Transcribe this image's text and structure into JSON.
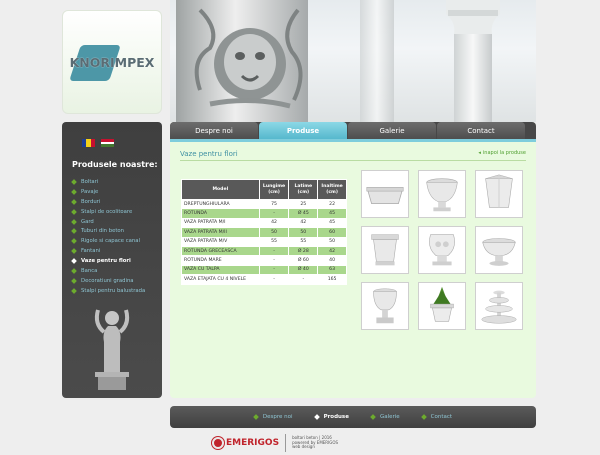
{
  "site": {
    "logo_text": "KNORIMPEX"
  },
  "colors": {
    "accent": "#56b8cd",
    "green": "#6dab2e",
    "panel": "#e9fadf",
    "dark": "#474747"
  },
  "sidebar": {
    "title": "Produsele noastre:",
    "items": [
      {
        "label": "Boltari"
      },
      {
        "label": "Pavaje"
      },
      {
        "label": "Borduri"
      },
      {
        "label": "Stalpi de ocolitoare"
      },
      {
        "label": "Gard"
      },
      {
        "label": "Tuburi din beton"
      },
      {
        "label": "Rigole si capace canal"
      },
      {
        "label": "Fantani"
      },
      {
        "label": "Vaze pentru flori"
      },
      {
        "label": "Banca"
      },
      {
        "label": "Decoratiuni gradina"
      },
      {
        "label": "Stalpi pentru balustrada"
      }
    ],
    "active_index": 8
  },
  "tabs": [
    {
      "label": "Despre noi"
    },
    {
      "label": "Produse"
    },
    {
      "label": "Galerie"
    },
    {
      "label": "Contact"
    }
  ],
  "content": {
    "section_title": "Vaze pentru flori",
    "back_link": "inapoi la produse",
    "table": {
      "headers": [
        "Model",
        "Lungime (cm)",
        "Latime (cm)",
        "Inaltime (cm)"
      ],
      "header_lines": [
        [
          "Model"
        ],
        [
          "Lungime",
          "(cm)"
        ],
        [
          "Latime",
          "(cm)"
        ],
        [
          "Inaltime",
          "(cm)"
        ]
      ],
      "rows": [
        [
          "DREPTUNGHIULARA",
          "75",
          "25",
          "22"
        ],
        [
          "ROTUNDA",
          "-",
          "Ø 45",
          "45"
        ],
        [
          "VAZA PATRATA M/I",
          "42",
          "42",
          "45"
        ],
        [
          "VAZA PATRATA M/II",
          "50",
          "50",
          "60"
        ],
        [
          "VAZA PATRATA M/V",
          "55",
          "55",
          "50"
        ],
        [
          "ROTUNDA GRECEASCA",
          "-",
          "Ø 28",
          "42"
        ],
        [
          "ROTUNDA MARE",
          "-",
          "Ø 60",
          "40"
        ],
        [
          "VAZA CU TALPA",
          "-",
          "Ø 40",
          "63"
        ],
        [
          "VAZA ETAJATA CU 4 NIVELE",
          "-",
          "-",
          "165"
        ]
      ]
    },
    "products": [
      {
        "icon": "rectangular-planter-icon"
      },
      {
        "icon": "round-urn-icon"
      },
      {
        "icon": "square-tapered-planter-icon"
      },
      {
        "icon": "square-planter-icon"
      },
      {
        "icon": "greek-round-vase-icon"
      },
      {
        "icon": "round-bowl-planter-icon"
      },
      {
        "icon": "footed-urn-icon"
      },
      {
        "icon": "planter-with-plant-icon"
      },
      {
        "icon": "tiered-fountain-vase-icon"
      }
    ]
  },
  "footer": {
    "nav": [
      {
        "label": "Despre noi"
      },
      {
        "label": "Produse"
      },
      {
        "label": "Galerie"
      },
      {
        "label": "Contact"
      }
    ],
    "active_index": 1,
    "credit_logo": "EMERIGOS",
    "credit_lines": [
      "boltari beton | 2016",
      "powered by EMERIGOS",
      "web design"
    ]
  }
}
